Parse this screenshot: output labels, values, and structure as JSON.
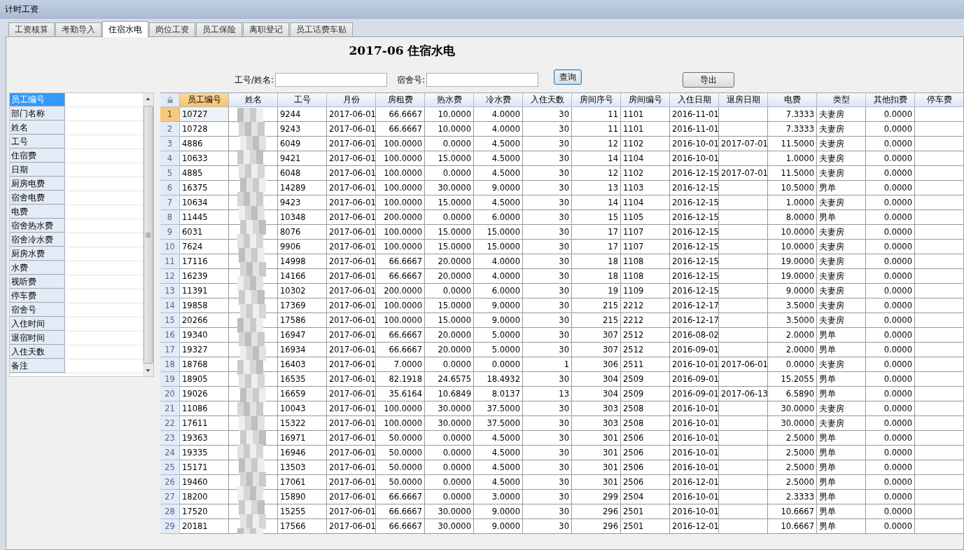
{
  "window": {
    "title": "计时工资"
  },
  "tabs": [
    {
      "label": "工资核算",
      "selected": false
    },
    {
      "label": "考勤导入",
      "selected": false
    },
    {
      "label": "住宿水电",
      "selected": true
    },
    {
      "label": "岗位工资",
      "selected": false
    },
    {
      "label": "员工保险",
      "selected": false
    },
    {
      "label": "离职登记",
      "selected": false
    },
    {
      "label": "员工话费车贴",
      "selected": false
    }
  ],
  "heading": "2017-06 住宿水电",
  "search": {
    "employee_label": "工号/姓名:",
    "dorm_label": "宿舍号:",
    "query_button": "查询",
    "export_button": "导出"
  },
  "field_list": [
    {
      "label": "员工编号",
      "selected": true
    },
    {
      "label": "部门名称",
      "selected": false
    },
    {
      "label": "姓名",
      "selected": false
    },
    {
      "label": "工号",
      "selected": false
    },
    {
      "label": "住宿费",
      "selected": false
    },
    {
      "label": "日期",
      "selected": false
    },
    {
      "label": "厨房电费",
      "selected": false
    },
    {
      "label": "宿舍电费",
      "selected": false
    },
    {
      "label": "电费",
      "selected": false
    },
    {
      "label": "宿舍热水费",
      "selected": false
    },
    {
      "label": "宿舍冷水费",
      "selected": false
    },
    {
      "label": "厨房水费",
      "selected": false
    },
    {
      "label": "水费",
      "selected": false
    },
    {
      "label": "视听费",
      "selected": false
    },
    {
      "label": "停车费",
      "selected": false
    },
    {
      "label": "宿舍号",
      "selected": false
    },
    {
      "label": "入住时间",
      "selected": false
    },
    {
      "label": "退宿时间",
      "selected": false
    },
    {
      "label": "入住天数",
      "selected": false
    },
    {
      "label": "备注",
      "selected": false
    }
  ],
  "table": {
    "columns": [
      {
        "label": "员工编号",
        "kind": "text",
        "selected": true
      },
      {
        "label": "姓名",
        "kind": "text",
        "selected": false
      },
      {
        "label": "工号",
        "kind": "text",
        "selected": false
      },
      {
        "label": "月份",
        "kind": "text",
        "selected": false
      },
      {
        "label": "房租费",
        "kind": "number",
        "selected": false
      },
      {
        "label": "热水费",
        "kind": "number",
        "selected": false
      },
      {
        "label": "冷水费",
        "kind": "number",
        "selected": false
      },
      {
        "label": "入住天数",
        "kind": "number",
        "selected": false
      },
      {
        "label": "房间序号",
        "kind": "number",
        "selected": false
      },
      {
        "label": "房间编号",
        "kind": "text",
        "selected": false
      },
      {
        "label": "入住日期",
        "kind": "text",
        "selected": false
      },
      {
        "label": "退房日期",
        "kind": "text",
        "selected": false
      },
      {
        "label": "电费",
        "kind": "number",
        "selected": false
      },
      {
        "label": "类型",
        "kind": "text",
        "selected": false
      },
      {
        "label": "其他扣费",
        "kind": "number",
        "selected": false
      },
      {
        "label": "停车费",
        "kind": "number",
        "selected": false
      }
    ],
    "rows": [
      {
        "number": "1",
        "selected": true,
        "emp": "10727",
        "job": "9244",
        "month": "2017-06-01",
        "rent": "66.6667",
        "hot": "10.0000",
        "cold": "4.0000",
        "days": "30",
        "seq": "11",
        "room": "1101",
        "in": "2016-11-01",
        "elec": "7.3333",
        "type": "夫妻房",
        "other": "0.0000"
      },
      {
        "number": "2",
        "selected": false,
        "emp": "10728",
        "job": "9243",
        "month": "2017-06-01",
        "rent": "66.6667",
        "hot": "10.0000",
        "cold": "4.0000",
        "days": "30",
        "seq": "11",
        "room": "1101",
        "in": "2016-11-01",
        "elec": "7.3333",
        "type": "夫妻房",
        "other": "0.0000"
      },
      {
        "number": "3",
        "selected": false,
        "emp": "4886",
        "job": "6049",
        "month": "2017-06-01",
        "rent": "100.0000",
        "hot": "0.0000",
        "cold": "4.5000",
        "days": "30",
        "seq": "12",
        "room": "1102",
        "in": "2016-10-01",
        "out": "2017-07-01",
        "elec": "11.5000",
        "type": "夫妻房",
        "other": "0.0000"
      },
      {
        "number": "4",
        "selected": false,
        "emp": "10633",
        "job": "9421",
        "month": "2017-06-01",
        "rent": "100.0000",
        "hot": "15.0000",
        "cold": "4.5000",
        "days": "30",
        "seq": "14",
        "room": "1104",
        "in": "2016-10-01",
        "elec": "1.0000",
        "type": "夫妻房",
        "other": "0.0000"
      },
      {
        "number": "5",
        "selected": false,
        "emp": "4885",
        "job": "6048",
        "month": "2017-06-01",
        "rent": "100.0000",
        "hot": "0.0000",
        "cold": "4.5000",
        "days": "30",
        "seq": "12",
        "room": "1102",
        "in": "2016-12-15",
        "out": "2017-07-01",
        "elec": "11.5000",
        "type": "夫妻房",
        "other": "0.0000"
      },
      {
        "number": "6",
        "selected": false,
        "emp": "16375",
        "job": "14289",
        "month": "2017-06-01",
        "rent": "100.0000",
        "hot": "30.0000",
        "cold": "9.0000",
        "days": "30",
        "seq": "13",
        "room": "1103",
        "in": "2016-12-15",
        "elec": "10.5000",
        "type": "男单",
        "other": "0.0000"
      },
      {
        "number": "7",
        "selected": false,
        "emp": "10634",
        "job": "9423",
        "month": "2017-06-01",
        "rent": "100.0000",
        "hot": "15.0000",
        "cold": "4.5000",
        "days": "30",
        "seq": "14",
        "room": "1104",
        "in": "2016-12-15",
        "elec": "1.0000",
        "type": "夫妻房",
        "other": "0.0000"
      },
      {
        "number": "8",
        "selected": false,
        "emp": "11445",
        "job": "10348",
        "month": "2017-06-01",
        "rent": "200.0000",
        "hot": "0.0000",
        "cold": "6.0000",
        "days": "30",
        "seq": "15",
        "room": "1105",
        "in": "2016-12-15",
        "elec": "8.0000",
        "type": "男单",
        "other": "0.0000"
      },
      {
        "number": "9",
        "selected": false,
        "emp": "6031",
        "job": "8076",
        "month": "2017-06-01",
        "rent": "100.0000",
        "hot": "15.0000",
        "cold": "15.0000",
        "days": "30",
        "seq": "17",
        "room": "1107",
        "in": "2016-12-15",
        "elec": "10.0000",
        "type": "夫妻房",
        "other": "0.0000"
      },
      {
        "number": "10",
        "selected": false,
        "emp": "7624",
        "job": "9906",
        "month": "2017-06-01",
        "rent": "100.0000",
        "hot": "15.0000",
        "cold": "15.0000",
        "days": "30",
        "seq": "17",
        "room": "1107",
        "in": "2016-12-15",
        "elec": "10.0000",
        "type": "夫妻房",
        "other": "0.0000"
      },
      {
        "number": "11",
        "selected": false,
        "emp": "17116",
        "job": "14998",
        "month": "2017-06-01",
        "rent": "66.6667",
        "hot": "20.0000",
        "cold": "4.0000",
        "days": "30",
        "seq": "18",
        "room": "1108",
        "in": "2016-12-15",
        "elec": "19.0000",
        "type": "夫妻房",
        "other": "0.0000"
      },
      {
        "number": "12",
        "selected": false,
        "emp": "16239",
        "job": "14166",
        "month": "2017-06-01",
        "rent": "66.6667",
        "hot": "20.0000",
        "cold": "4.0000",
        "days": "30",
        "seq": "18",
        "room": "1108",
        "in": "2016-12-15",
        "elec": "19.0000",
        "type": "夫妻房",
        "other": "0.0000"
      },
      {
        "number": "13",
        "selected": false,
        "emp": "11391",
        "job": "10302",
        "month": "2017-06-01",
        "rent": "200.0000",
        "hot": "0.0000",
        "cold": "6.0000",
        "days": "30",
        "seq": "19",
        "room": "1109",
        "in": "2016-12-15",
        "elec": "9.0000",
        "type": "夫妻房",
        "other": "0.0000"
      },
      {
        "number": "14",
        "selected": false,
        "emp": "19858",
        "job": "17369",
        "month": "2017-06-01",
        "rent": "100.0000",
        "hot": "15.0000",
        "cold": "9.0000",
        "days": "30",
        "seq": "215",
        "room": "2212",
        "in": "2016-12-17",
        "elec": "3.5000",
        "type": "夫妻房",
        "other": "0.0000"
      },
      {
        "number": "15",
        "selected": false,
        "emp": "20266",
        "job": "17586",
        "month": "2017-06-01",
        "rent": "100.0000",
        "hot": "15.0000",
        "cold": "9.0000",
        "days": "30",
        "seq": "215",
        "room": "2212",
        "in": "2016-12-17",
        "elec": "3.5000",
        "type": "夫妻房",
        "other": "0.0000"
      },
      {
        "number": "16",
        "selected": false,
        "emp": "19340",
        "job": "16947",
        "month": "2017-06-01",
        "rent": "66.6667",
        "hot": "20.0000",
        "cold": "5.0000",
        "days": "30",
        "seq": "307",
        "room": "2512",
        "in": "2016-08-02",
        "elec": "2.0000",
        "type": "男单",
        "other": "0.0000"
      },
      {
        "number": "17",
        "selected": false,
        "emp": "19327",
        "job": "16934",
        "month": "2017-06-01",
        "rent": "66.6667",
        "hot": "20.0000",
        "cold": "5.0000",
        "days": "30",
        "seq": "307",
        "room": "2512",
        "in": "2016-09-01",
        "elec": "2.0000",
        "type": "男单",
        "other": "0.0000"
      },
      {
        "number": "18",
        "selected": false,
        "emp": "18768",
        "job": "16403",
        "month": "2017-06-01",
        "rent": "7.0000",
        "hot": "0.0000",
        "cold": "0.0000",
        "days": "1",
        "seq": "306",
        "room": "2511",
        "in": "2016-10-01",
        "out": "2017-06-01",
        "elec": "0.0000",
        "type": "夫妻房",
        "other": "0.0000"
      },
      {
        "number": "19",
        "selected": false,
        "emp": "18905",
        "job": "16535",
        "month": "2017-06-01",
        "rent": "82.1918",
        "hot": "24.6575",
        "cold": "18.4932",
        "days": "30",
        "seq": "304",
        "room": "2509",
        "in": "2016-09-01",
        "elec": "15.2055",
        "type": "男单",
        "other": "0.0000"
      },
      {
        "number": "20",
        "selected": false,
        "emp": "19026",
        "job": "16659",
        "month": "2017-06-01",
        "rent": "35.6164",
        "hot": "10.6849",
        "cold": "8.0137",
        "days": "13",
        "seq": "304",
        "room": "2509",
        "in": "2016-09-01",
        "out": "2017-06-13",
        "elec": "6.5890",
        "type": "男单",
        "other": "0.0000"
      },
      {
        "number": "21",
        "selected": false,
        "emp": "11086",
        "job": "10043",
        "month": "2017-06-01",
        "rent": "100.0000",
        "hot": "30.0000",
        "cold": "37.5000",
        "days": "30",
        "seq": "303",
        "room": "2508",
        "in": "2016-10-01",
        "elec": "30.0000",
        "type": "夫妻房",
        "other": "0.0000"
      },
      {
        "number": "22",
        "selected": false,
        "emp": "17611",
        "job": "15322",
        "month": "2017-06-01",
        "rent": "100.0000",
        "hot": "30.0000",
        "cold": "37.5000",
        "days": "30",
        "seq": "303",
        "room": "2508",
        "in": "2016-10-01",
        "elec": "30.0000",
        "type": "夫妻房",
        "other": "0.0000"
      },
      {
        "number": "23",
        "selected": false,
        "emp": "19363",
        "job": "16971",
        "month": "2017-06-01",
        "rent": "50.0000",
        "hot": "0.0000",
        "cold": "4.5000",
        "days": "30",
        "seq": "301",
        "room": "2506",
        "in": "2016-10-01",
        "elec": "2.5000",
        "type": "男单",
        "other": "0.0000"
      },
      {
        "number": "24",
        "selected": false,
        "emp": "19335",
        "job": "16946",
        "month": "2017-06-01",
        "rent": "50.0000",
        "hot": "0.0000",
        "cold": "4.5000",
        "days": "30",
        "seq": "301",
        "room": "2506",
        "in": "2016-10-01",
        "elec": "2.5000",
        "type": "男单",
        "other": "0.0000"
      },
      {
        "number": "25",
        "selected": false,
        "emp": "15171",
        "job": "13503",
        "month": "2017-06-01",
        "rent": "50.0000",
        "hot": "0.0000",
        "cold": "4.5000",
        "days": "30",
        "seq": "301",
        "room": "2506",
        "in": "2016-10-01",
        "elec": "2.5000",
        "type": "男单",
        "other": "0.0000"
      },
      {
        "number": "26",
        "selected": false,
        "emp": "19460",
        "job": "17061",
        "month": "2017-06-01",
        "rent": "50.0000",
        "hot": "0.0000",
        "cold": "4.5000",
        "days": "30",
        "seq": "301",
        "room": "2506",
        "in": "2016-12-01",
        "elec": "2.5000",
        "type": "男单",
        "other": "0.0000"
      },
      {
        "number": "27",
        "selected": false,
        "emp": "18200",
        "job": "15890",
        "month": "2017-06-01",
        "rent": "66.6667",
        "hot": "0.0000",
        "cold": "3.0000",
        "days": "30",
        "seq": "299",
        "room": "2504",
        "in": "2016-10-01",
        "elec": "2.3333",
        "type": "男单",
        "other": "0.0000"
      },
      {
        "number": "28",
        "selected": false,
        "emp": "17520",
        "job": "15255",
        "month": "2017-06-01",
        "rent": "66.6667",
        "hot": "30.0000",
        "cold": "9.0000",
        "days": "30",
        "seq": "296",
        "room": "2501",
        "in": "2016-10-01",
        "elec": "10.6667",
        "type": "男单",
        "other": "0.0000"
      },
      {
        "number": "29",
        "selected": false,
        "emp": "20181",
        "job": "17566",
        "month": "2017-06-01",
        "rent": "66.6667",
        "hot": "30.0000",
        "cold": "9.0000",
        "days": "30",
        "seq": "296",
        "room": "2501",
        "in": "2016-12-01",
        "elec": "10.6667",
        "type": "男单",
        "other": "0.0000"
      }
    ]
  }
}
